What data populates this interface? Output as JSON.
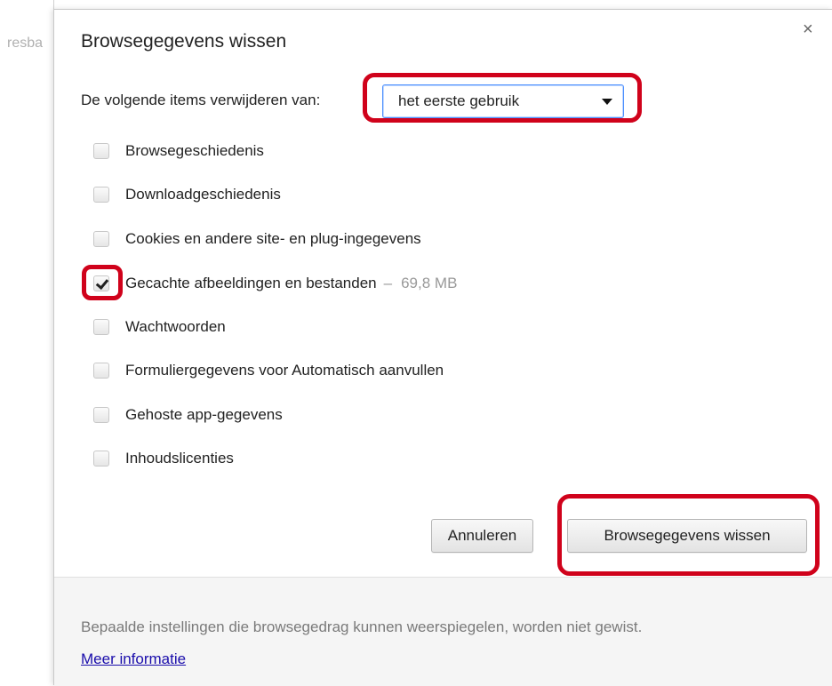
{
  "background": {
    "peek_text": "resba"
  },
  "dialog": {
    "title": "Browsegegevens wissen",
    "close_label": "×",
    "time_range": {
      "label": "De volgende items verwijderen van:",
      "selected": "het eerste gebruik"
    },
    "options": [
      {
        "label": "Browsegeschiedenis",
        "checked": false
      },
      {
        "label": "Downloadgeschiedenis",
        "checked": false
      },
      {
        "label": "Cookies en andere site- en plug-ingegevens",
        "checked": false
      },
      {
        "label": "Gecachte afbeeldingen en bestanden",
        "checked": true,
        "separator": "–",
        "size": "69,8 MB"
      },
      {
        "label": "Wachtwoorden",
        "checked": false
      },
      {
        "label": "Formuliergegevens voor Automatisch aanvullen",
        "checked": false
      },
      {
        "label": "Gehoste app-gegevens",
        "checked": false
      },
      {
        "label": "Inhoudslicenties",
        "checked": false
      }
    ],
    "buttons": {
      "cancel": "Annuleren",
      "clear": "Browsegegevens wissen"
    },
    "footer": {
      "note": "Bepaalde instellingen die browsegedrag kunnen weerspiegelen, worden niet gewist.",
      "link": "Meer informatie"
    }
  },
  "colors": {
    "highlight": "#d0021b",
    "link": "#1a0dab",
    "focus": "#4d90fe"
  }
}
